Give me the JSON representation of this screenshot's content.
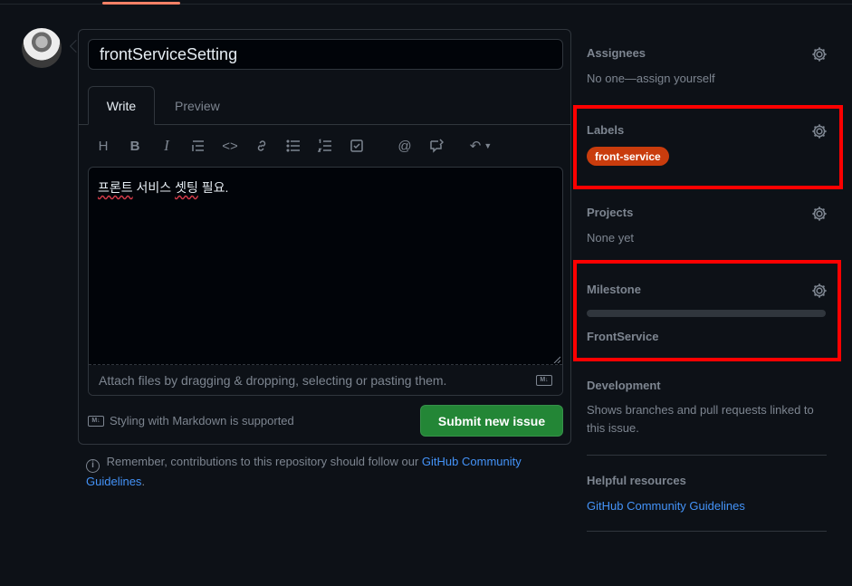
{
  "issue": {
    "title_value": "frontServiceSetting",
    "tabs": [
      {
        "label": "Write"
      },
      {
        "label": "Preview"
      }
    ],
    "body_text": {
      "word1": "프론트",
      "word2": "서비스",
      "word3": "셋팅",
      "word4": "필요."
    },
    "attach_hint": "Attach files by dragging & dropping, selecting or pasting them.",
    "markdown_note": "Styling with Markdown is supported",
    "submit_label": "Submit new issue",
    "md_badge": "M↓"
  },
  "toolbar": {
    "icons": [
      "heading-icon",
      "bold-icon",
      "italic-icon",
      "quote-icon",
      "code-icon",
      "link-icon",
      "bulleted-list-icon",
      "numbered-list-icon",
      "task-list-icon",
      "mention-icon",
      "reference-icon",
      "undo-icon"
    ],
    "heading_glyph": "H",
    "bold_glyph": "B",
    "italic_glyph": "I",
    "code_glyph": "<>",
    "mention_glyph": "@",
    "undo_glyph": "↶"
  },
  "guidelines_note": {
    "prefix": "Remember, contributions to this repository should follow our",
    "link1": "GitHub Community",
    "link2": "Guidelines",
    "suffix": "."
  },
  "sidebar": {
    "assignees": {
      "title": "Assignees",
      "value": "No one—assign yourself"
    },
    "labels": {
      "title": "Labels",
      "items": [
        {
          "name": "front-service",
          "color": "#c93c0d"
        }
      ]
    },
    "projects": {
      "title": "Projects",
      "value": "None yet"
    },
    "milestone": {
      "title": "Milestone",
      "name": "FrontService"
    },
    "development": {
      "title": "Development",
      "text": "Shows branches and pull requests linked to this issue."
    },
    "helpful": {
      "title": "Helpful resources",
      "link": "GitHub Community Guidelines"
    }
  },
  "colors": {
    "background": "#0d1117",
    "border": "#30363d",
    "muted": "#7d8590",
    "accent_link": "#4493f8",
    "submit_bg": "#238636",
    "highlight_box": "#ff0000"
  }
}
